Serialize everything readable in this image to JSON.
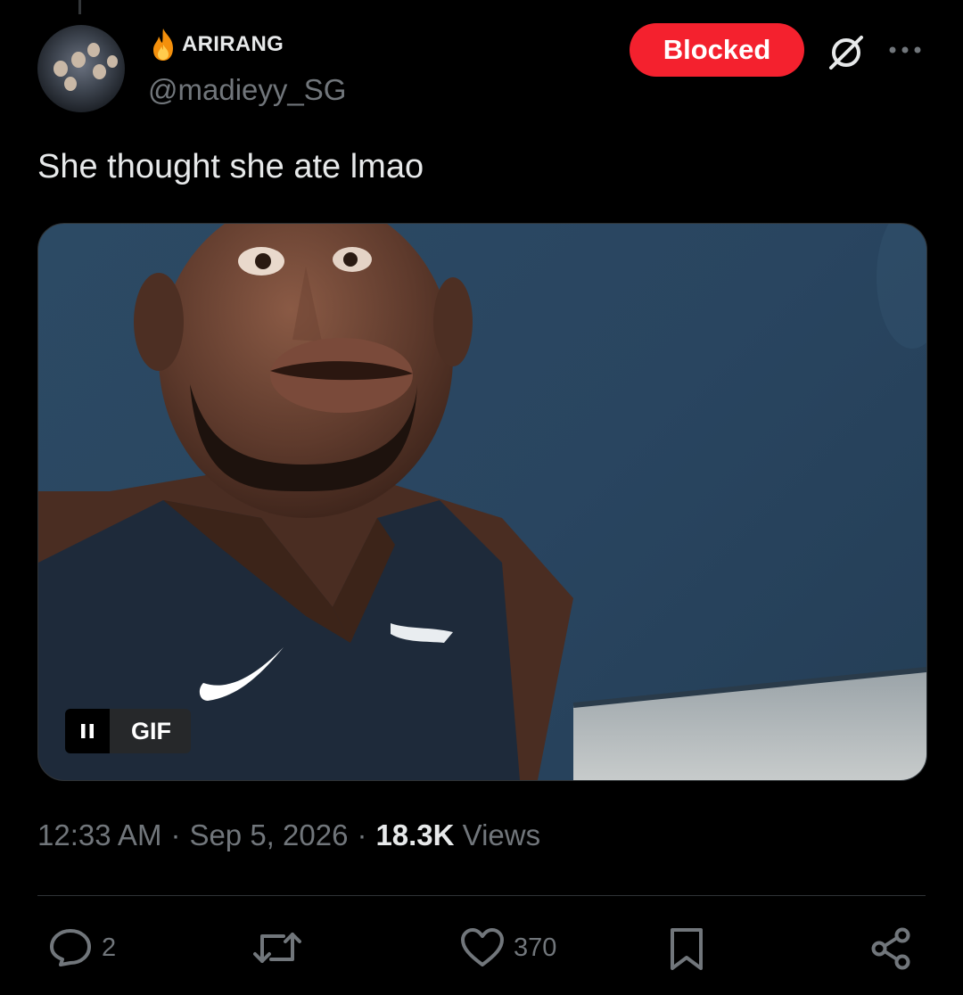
{
  "tweet": {
    "author": {
      "display_name": "ARIRANG",
      "name_emoji_icon": "fire-icon",
      "handle": "@madieyy_SG",
      "avatar": "group-photo-avatar"
    },
    "header_actions": {
      "blocked_label": "Blocked",
      "grok_icon": "grok-icon",
      "more_icon": "more-options-icon"
    },
    "text": "She thought she ate lmao",
    "media": {
      "type": "gif",
      "gif_label": "GIF",
      "pause_icon": "pause-icon"
    },
    "meta": {
      "time": "12:33 AM",
      "sep1": "·",
      "date": "Sep 5, 2026",
      "sep2": "·",
      "views_count": "18.3K",
      "views_label": "Views"
    },
    "actions": {
      "reply_count": "2",
      "retweet_count": "",
      "like_count": "370",
      "icons": [
        "reply-icon",
        "retweet-icon",
        "like-icon",
        "bookmark-icon",
        "share-icon"
      ]
    }
  },
  "colors": {
    "background": "#000000",
    "text": "#e7e9ea",
    "secondary": "#71767b",
    "blocked": "#f4212e",
    "divider": "#2f3336"
  }
}
